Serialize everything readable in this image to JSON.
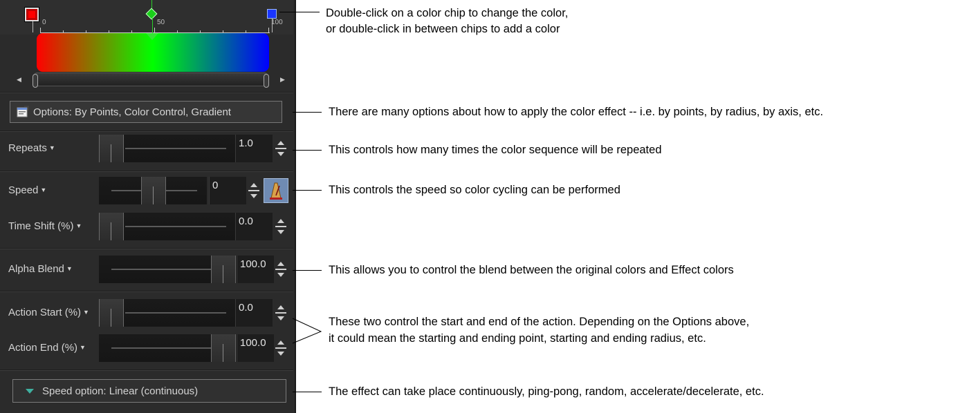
{
  "gradient_editor": {
    "tick_labels": [
      "0",
      "50",
      "100"
    ],
    "chips": [
      {
        "name": "red",
        "color": "#ff0000"
      },
      {
        "name": "green",
        "color": "#00ff00"
      },
      {
        "name": "blue",
        "color": "#0000ff"
      }
    ],
    "gradient_colors": [
      "#ff0000",
      "#00ff00",
      "#0000ff"
    ]
  },
  "options": {
    "label": "Options: By Points, Color Control, Gradient",
    "icon": "options-window-icon"
  },
  "controls": {
    "repeats": {
      "label": "Repeats",
      "value": "1.0",
      "level": 0.0
    },
    "speed": {
      "label": "Speed",
      "value": "0",
      "level": 0.5,
      "icon": "metronome-icon"
    },
    "time_shift": {
      "label": "Time Shift (%)",
      "value": "0.0",
      "level": 0.0
    },
    "alpha_blend": {
      "label": "Alpha Blend",
      "value": "100.0",
      "level": 1.0
    },
    "action_start": {
      "label": "Action Start (%)",
      "value": "0.0",
      "level": 0.0
    },
    "action_end": {
      "label": "Action End (%)",
      "value": "100.0",
      "level": 1.0
    }
  },
  "speed_option": {
    "label": "Speed option: Linear (continuous)",
    "icon": "expand-triangle-icon"
  },
  "annotations": {
    "chips_line1": "Double-click on a color chip to change the color,",
    "chips_line2": "or double-click in between chips to add a color",
    "options": "There are many options about how to apply the color effect -- i.e. by points, by radius, by axis, etc.",
    "repeats": "This controls how many times the color sequence will be repeated",
    "speed": "This controls the speed so color cycling can be performed",
    "alpha": "This allows you to control the blend between the original colors and Effect colors",
    "action_line1": "These two control the start and end of the action. Depending on the Options above,",
    "action_line2": "it could mean the starting and ending point, starting and ending radius, etc.",
    "speed_option": "The effect can take place continuously, ping-pong, random, accelerate/decelerate, etc."
  }
}
